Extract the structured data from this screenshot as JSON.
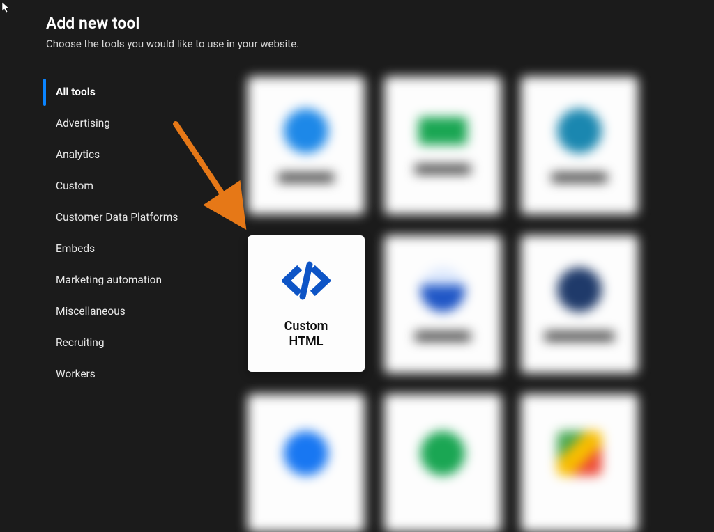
{
  "header": {
    "title": "Add new tool",
    "subtitle": "Choose the tools you would like to use in your website."
  },
  "sidebar": {
    "items": [
      {
        "label": "All tools",
        "active": true
      },
      {
        "label": "Advertising",
        "active": false
      },
      {
        "label": "Analytics",
        "active": false
      },
      {
        "label": "Custom",
        "active": false
      },
      {
        "label": "Customer Data Platforms",
        "active": false
      },
      {
        "label": "Embeds",
        "active": false
      },
      {
        "label": "Marketing automation",
        "active": false
      },
      {
        "label": "Miscellaneous",
        "active": false
      },
      {
        "label": "Recruiting",
        "active": false
      },
      {
        "label": "Workers",
        "active": false
      }
    ]
  },
  "grid": {
    "focused_index": 3,
    "tools": [
      {
        "label": "",
        "blurred": true,
        "icon": "blue-circle"
      },
      {
        "label": "",
        "blurred": true,
        "icon": "green-logo"
      },
      {
        "label": "",
        "blurred": true,
        "icon": "teal-circle"
      },
      {
        "label": "Custom HTML",
        "blurred": false,
        "icon": "code-slash"
      },
      {
        "label": "",
        "blurred": true,
        "icon": "image-placeholder"
      },
      {
        "label": "",
        "blurred": true,
        "icon": "navy-circle"
      },
      {
        "label": "",
        "blurred": true,
        "icon": "fb-circle"
      },
      {
        "label": "",
        "blurred": true,
        "icon": "green-circle"
      },
      {
        "label": "",
        "blurred": true,
        "icon": "google-logo"
      }
    ]
  },
  "annotation": {
    "arrow_color": "#e67817"
  }
}
